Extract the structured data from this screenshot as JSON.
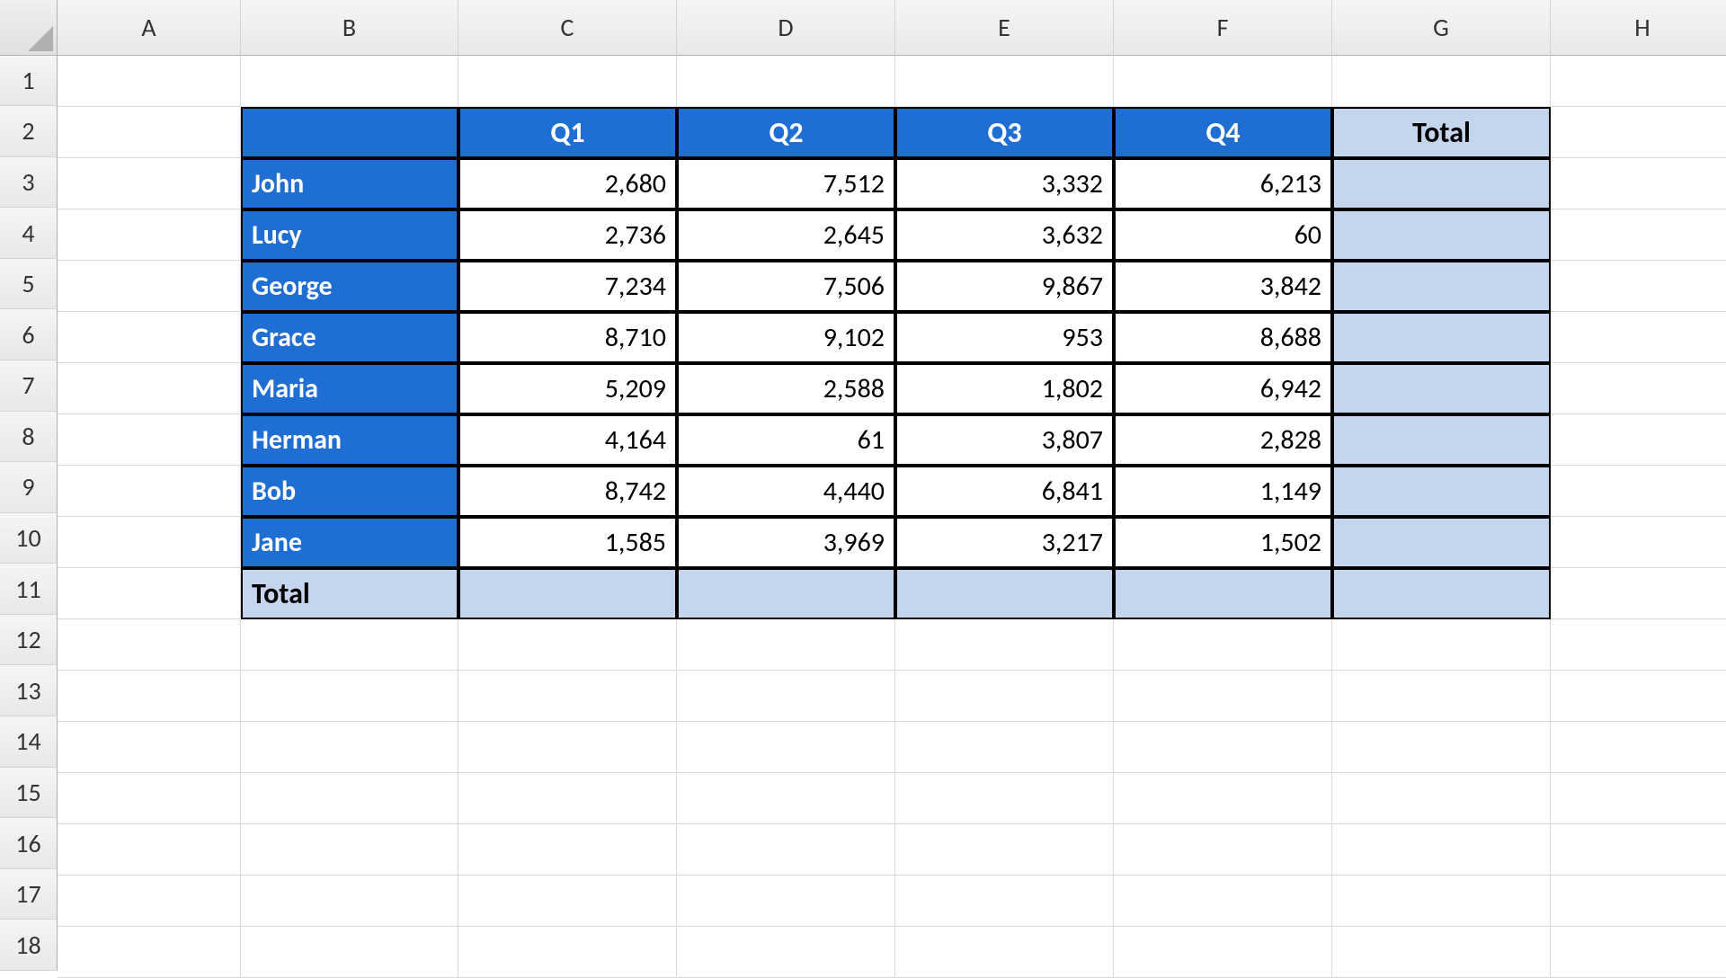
{
  "sheet": {
    "column_headers": [
      "A",
      "B",
      "C",
      "D",
      "E",
      "F",
      "G",
      "H"
    ],
    "row_headers": [
      "1",
      "2",
      "3",
      "4",
      "5",
      "6",
      "7",
      "8",
      "9",
      "10",
      "11",
      "12",
      "13",
      "14",
      "15",
      "16",
      "17",
      "18"
    ],
    "table": {
      "quarter_headers": [
        "Q1",
        "Q2",
        "Q3",
        "Q4"
      ],
      "total_header": "Total",
      "total_row_label": "Total",
      "rows": [
        {
          "name": "John",
          "values": [
            "2,680",
            "7,512",
            "3,332",
            "6,213"
          ]
        },
        {
          "name": "Lucy",
          "values": [
            "2,736",
            "2,645",
            "3,632",
            "60"
          ]
        },
        {
          "name": "George",
          "values": [
            "7,234",
            "7,506",
            "9,867",
            "3,842"
          ]
        },
        {
          "name": "Grace",
          "values": [
            "8,710",
            "9,102",
            "953",
            "8,688"
          ]
        },
        {
          "name": "Maria",
          "values": [
            "5,209",
            "2,588",
            "1,802",
            "6,942"
          ]
        },
        {
          "name": "Herman",
          "values": [
            "4,164",
            "61",
            "3,807",
            "2,828"
          ]
        },
        {
          "name": "Bob",
          "values": [
            "8,742",
            "4,440",
            "6,841",
            "1,149"
          ]
        },
        {
          "name": "Jane",
          "values": [
            "1,585",
            "3,969",
            "3,217",
            "1,502"
          ]
        }
      ]
    }
  }
}
